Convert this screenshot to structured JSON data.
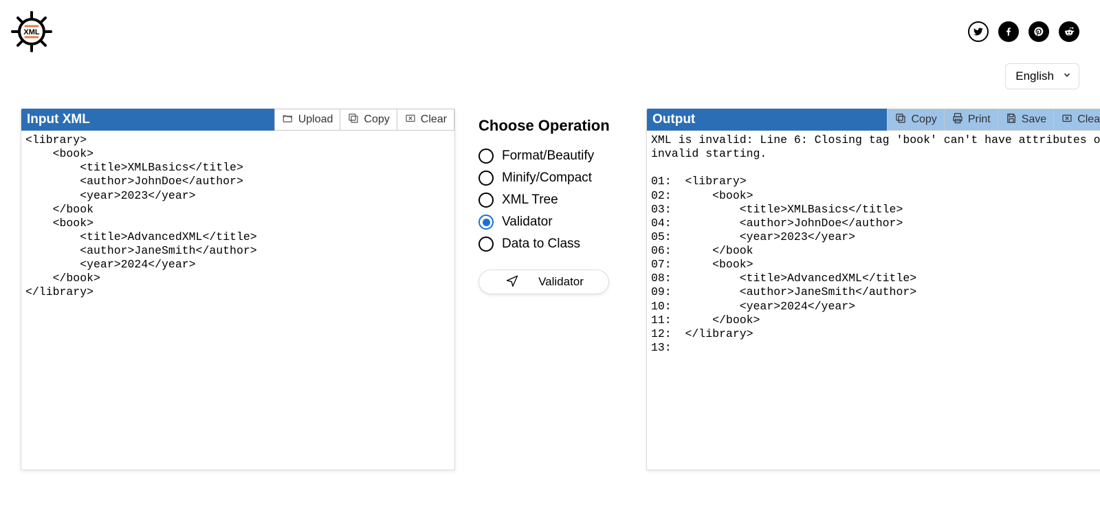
{
  "header": {
    "logo_text": "XML",
    "social_icons": [
      "twitter-icon",
      "facebook-icon",
      "pinterest-icon",
      "reddit-icon"
    ]
  },
  "language": {
    "selected": "English"
  },
  "input_panel": {
    "title": "Input XML",
    "toolbar": {
      "upload": "Upload",
      "copy": "Copy",
      "clear": "Clear"
    },
    "content": "<library>\n    <book>\n        <title>XMLBasics</title>\n        <author>JohnDoe</author>\n        <year>2023</year>\n    </book\n    <book>\n        <title>AdvancedXML</title>\n        <author>JaneSmith</author>\n        <year>2024</year>\n    </book>\n</library>"
  },
  "operations": {
    "title": "Choose Operation",
    "items": [
      {
        "label": "Format/Beautify",
        "selected": false
      },
      {
        "label": "Minify/Compact",
        "selected": false
      },
      {
        "label": "XML Tree",
        "selected": false
      },
      {
        "label": "Validator",
        "selected": true
      },
      {
        "label": "Data to Class",
        "selected": false
      }
    ],
    "run_label": "Validator"
  },
  "output_panel": {
    "title": "Output",
    "toolbar": {
      "copy": "Copy",
      "print": "Print",
      "save": "Save",
      "clear": "Clear"
    },
    "content": "XML is invalid: Line 6: Closing tag 'book' can't have attributes or\ninvalid starting.\n\n01:  <library>\n02:      <book>\n03:          <title>XMLBasics</title>\n04:          <author>JohnDoe</author>\n05:          <year>2023</year>\n06:      </book\n07:      <book>\n08:          <title>AdvancedXML</title>\n09:          <author>JaneSmith</author>\n10:          <year>2024</year>\n11:      </book>\n12:  </library>\n13:"
  }
}
